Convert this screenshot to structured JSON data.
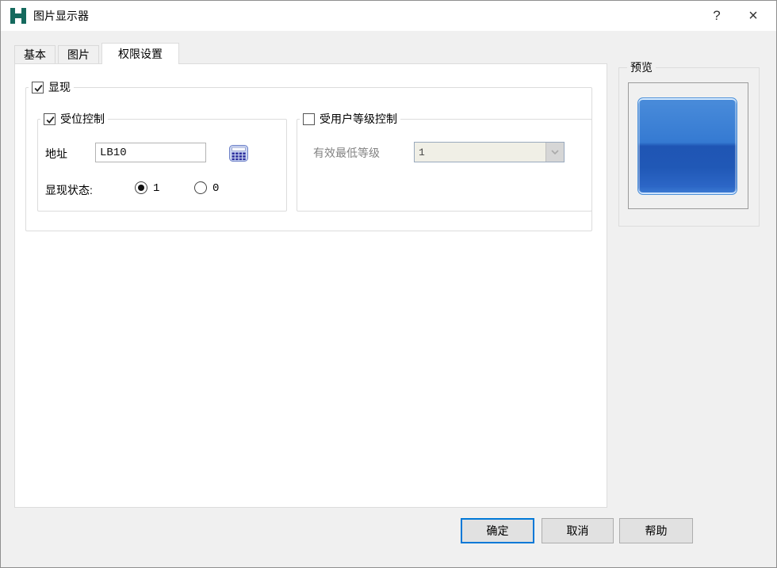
{
  "window": {
    "title": "图片显示器",
    "help_glyph": "?",
    "close_glyph": "×"
  },
  "tabs": [
    {
      "label": "基本",
      "active": false
    },
    {
      "label": "图片",
      "active": false
    },
    {
      "label": "权限设置",
      "active": true
    }
  ],
  "visibility_group": {
    "label": "显现",
    "checked": true
  },
  "bit_control_group": {
    "label": "受位控制",
    "checked": true,
    "address_label": "地址",
    "address_value": "LB10",
    "state_label": "显现状态:",
    "options": [
      {
        "label": "1",
        "selected": true
      },
      {
        "label": "0",
        "selected": false
      }
    ]
  },
  "user_level_group": {
    "label": "受用户等级控制",
    "checked": false,
    "min_level_label": "有效最低等级",
    "min_level_value": "1",
    "enabled": false
  },
  "preview_group": {
    "label": "预览"
  },
  "footer": {
    "ok": "确定",
    "cancel": "取消",
    "help": "帮助"
  },
  "icons": {
    "app_logo": "h-logo-icon",
    "address_picker": "calculator-icon",
    "combo_arrow": "chevron-down-icon",
    "help": "question-icon",
    "close": "close-icon"
  },
  "colors": {
    "accent": "#0078d7",
    "logo_teal": "#156a5e",
    "preview_blue_top": "#4a8cda",
    "preview_blue_bottom": "#2c66c6",
    "dialog_bg": "#f0f0f0"
  }
}
